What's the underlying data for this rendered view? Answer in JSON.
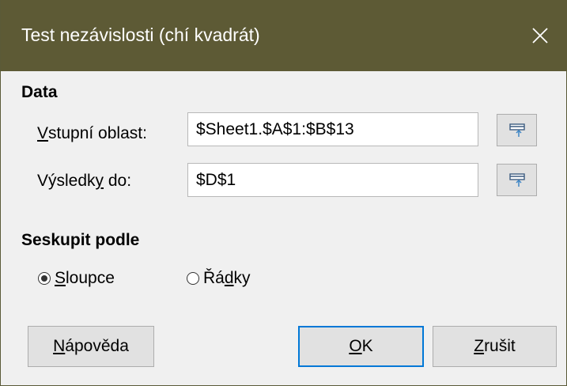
{
  "window": {
    "title": "Test nezávislosti (chí kvadrát)",
    "close_icon": "close-icon"
  },
  "data_section": {
    "title": "Data",
    "input_range": {
      "label_mnemonic": "V",
      "label_rest": "stupní oblast:",
      "value": "$Sheet1.$A$1:$B$13"
    },
    "results_to": {
      "label_before": "Výsledk",
      "label_mnemonic": "y",
      "label_after": " do:",
      "value": "$D$1"
    },
    "shrink_icon": "shrink-range-icon"
  },
  "group_section": {
    "title": "Seskupit podle",
    "options": [
      {
        "mnemonic": "S",
        "rest": "loupce",
        "checked": true
      },
      {
        "before": "Řá",
        "mnemonic": "d",
        "after": "ky",
        "checked": false
      }
    ]
  },
  "buttons": {
    "help": {
      "mnemonic": "N",
      "rest": "ápověda"
    },
    "ok": {
      "mnemonic": "O",
      "rest": "K"
    },
    "cancel": {
      "mnemonic": "Z",
      "rest": "rušit"
    }
  },
  "colors": {
    "titlebar": "#5d5a35",
    "focus_border": "#0078d7",
    "dialog_bg": "#f0f0f0"
  }
}
